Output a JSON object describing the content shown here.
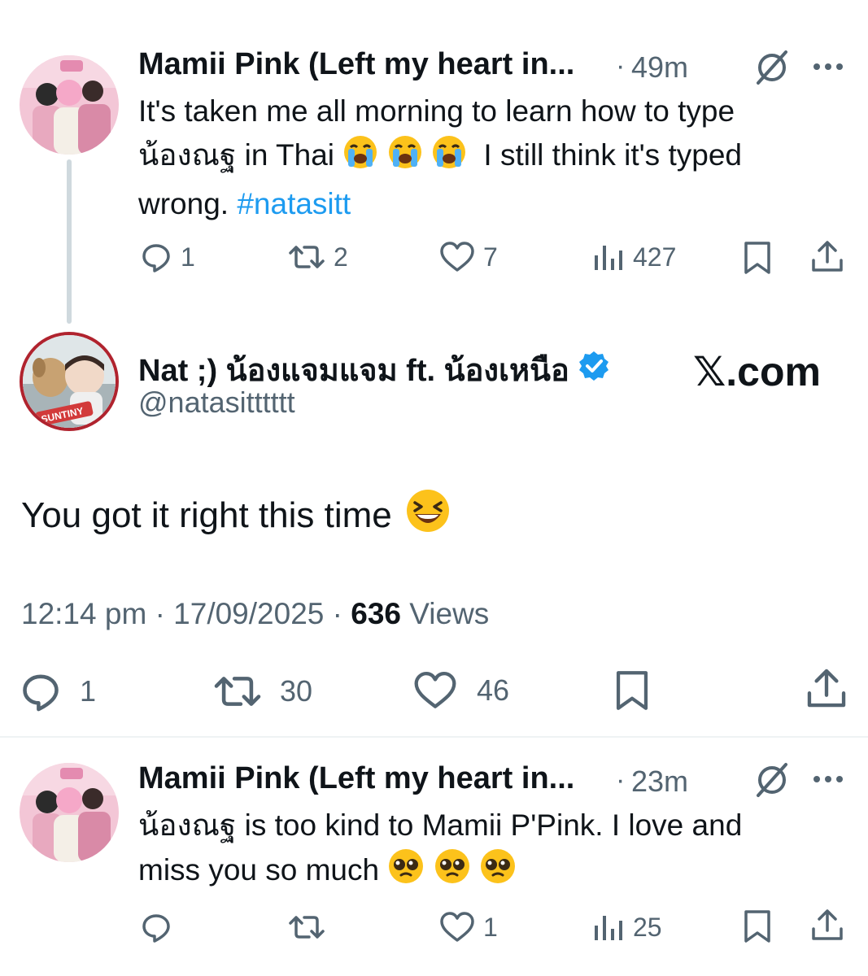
{
  "tweet1": {
    "name": "Mamii Pink (Left my heart in...",
    "sep": "·",
    "time": "49m",
    "text_before": "It's taken me all morning to learn how to type น้องณฐ in Thai",
    "text_mid": "I still think it's typed wrong.",
    "hashtag": "#natasitt",
    "emoji_name": "loudly-crying-face",
    "actions": {
      "replies": "1",
      "reposts": "2",
      "likes": "7",
      "views": "427"
    }
  },
  "main_tweet": {
    "name": "Nat ;) น้องแจมแจม ft. น้องเหนือ",
    "handle": "@natasitttttt",
    "watermark": "𝕏.com",
    "text": "You got it right this time",
    "emoji_name": "grinning-squinting-face",
    "time": "12:14 pm",
    "date": "17/09/2025",
    "sep": "·",
    "views_count": "636",
    "views_label": "Views",
    "actions": {
      "replies": "1",
      "reposts": "30",
      "likes": "46"
    },
    "avatar_text": "SUNTINY"
  },
  "tweet3": {
    "name": "Mamii Pink (Left my heart in...",
    "sep": "·",
    "time": "23m",
    "text_line1": "น้องณฐ is too kind to Mamii P'Pink. I love and",
    "text_line2": "miss you so much",
    "emoji_name": "pleading-face",
    "actions": {
      "replies": "",
      "reposts": "",
      "likes": "1",
      "views": "25"
    }
  },
  "colors": {
    "accent": "#1d9bf0",
    "muted": "#536471",
    "text": "#0f1419",
    "verified": "#1d9bf0"
  }
}
